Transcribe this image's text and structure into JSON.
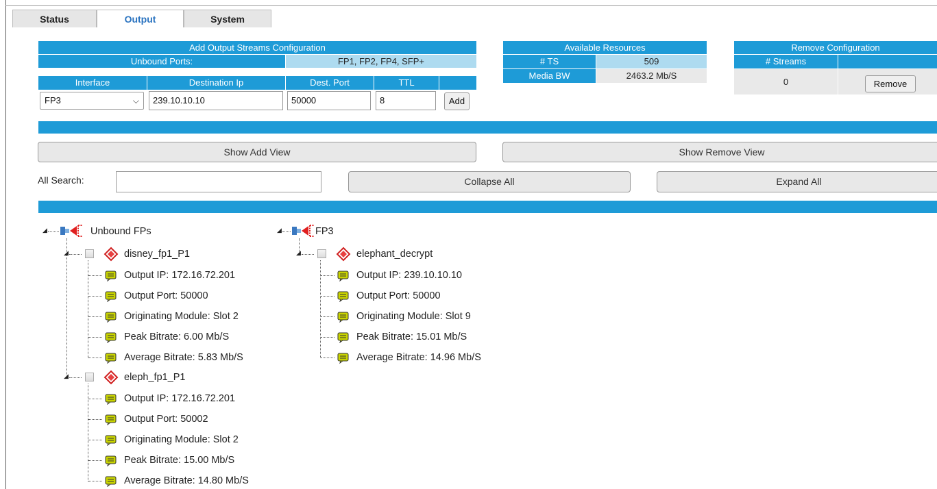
{
  "tabs": [
    {
      "label": "Status",
      "active": false
    },
    {
      "label": "Output",
      "active": true
    },
    {
      "label": "System",
      "active": false
    }
  ],
  "add_config": {
    "title": "Add Output Streams Configuration",
    "unbound_label": "Unbound Ports:",
    "unbound_value": "FP1, FP2, FP4, SFP+",
    "col_interface": "Interface",
    "col_dest_ip": "Destination Ip",
    "col_dest_port": "Dest. Port",
    "col_ttl": "TTL",
    "interface_value": "FP3",
    "dest_ip_value": "239.10.10.10",
    "dest_port_value": "50000",
    "ttl_value": "8",
    "add_label": "Add"
  },
  "resources": {
    "title": "Available Resources",
    "ts_label": "# TS",
    "ts_value": "509",
    "bw_label": "Media BW",
    "bw_value": "2463.2 Mb/S"
  },
  "remove_config": {
    "title": "Remove Configuration",
    "streams_label": "# Streams",
    "streams_value": "0",
    "remove_label": "Remove"
  },
  "views": {
    "show_add": "Show Add View",
    "show_remove": "Show Remove View",
    "search_label": "All Search:",
    "search_value": "",
    "collapse_all": "Collapse All",
    "expand_all": "Expand All"
  },
  "tree": {
    "unbound": {
      "label": "Unbound FPs",
      "streams": [
        {
          "name": "disney_fp1_P1",
          "props": [
            "Output IP: 172.16.72.201",
            "Output Port: 50000",
            "Originating Module: Slot 2",
            "Peak Bitrate: 6.00 Mb/S",
            "Average Bitrate: 5.83 Mb/S"
          ]
        },
        {
          "name": "eleph_fp1_P1",
          "props": [
            "Output IP: 172.16.72.201",
            "Output Port: 50002",
            "Originating Module: Slot 2",
            "Peak Bitrate: 15.00 Mb/S",
            "Average Bitrate: 14.80 Mb/S"
          ]
        }
      ]
    },
    "fp3": {
      "label": "FP3",
      "streams": [
        {
          "name": "elephant_decrypt",
          "props": [
            "Output IP: 239.10.10.10",
            "Output Port: 50000",
            "Originating Module: Slot 9",
            "Peak Bitrate: 15.01 Mb/S",
            "Average Bitrate: 14.96 Mb/S"
          ]
        }
      ]
    }
  },
  "icons": {
    "port": "port-connector-icon",
    "stream": "stream-tag-icon",
    "property": "property-note-icon"
  },
  "colors": {
    "header_blue": "#1e9bd7",
    "light_blue": "#aedbf0",
    "active_tab": "#2a73c0",
    "port_red": "#e02020",
    "note_green": "#c9d400"
  }
}
